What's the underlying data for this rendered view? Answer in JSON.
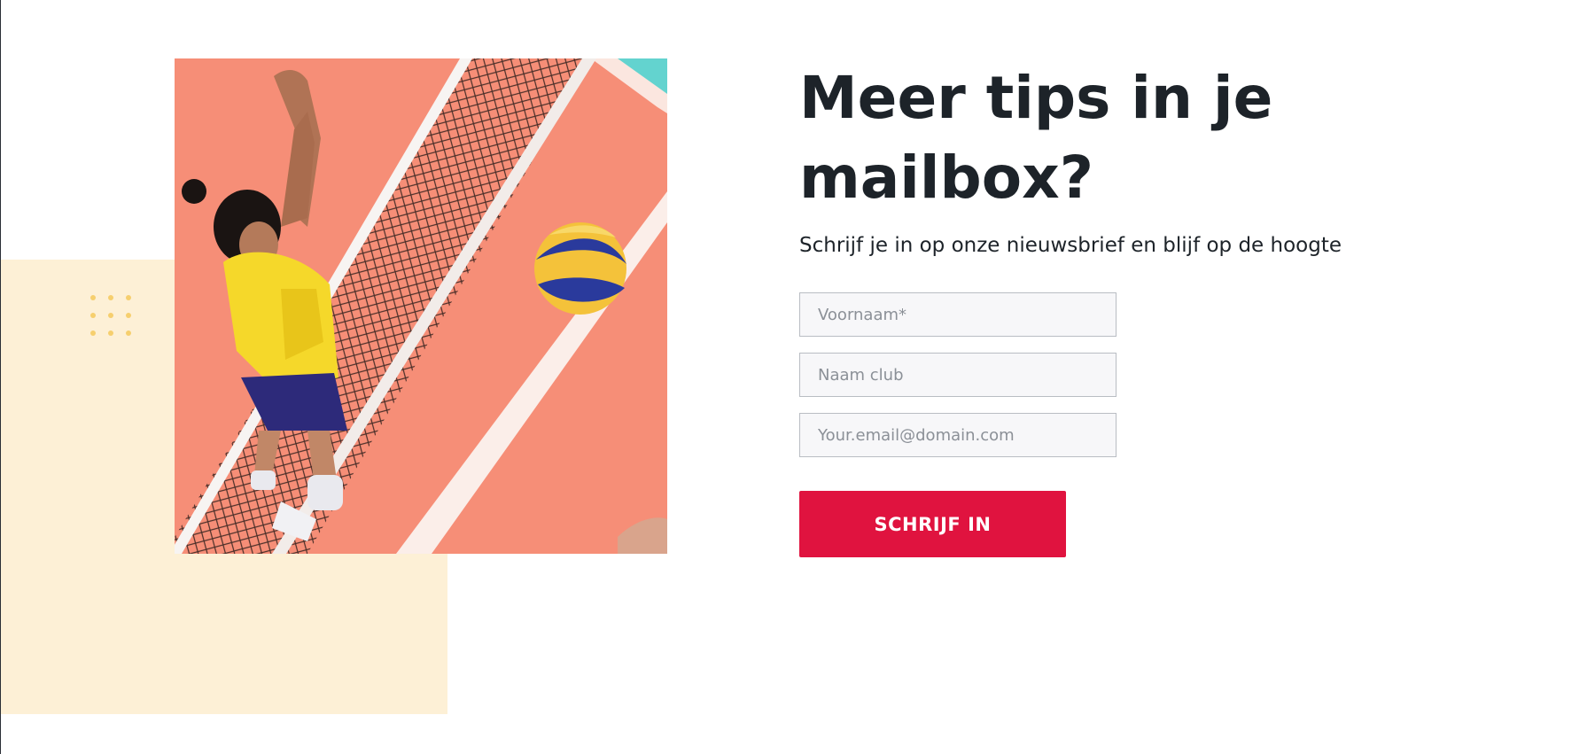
{
  "newsletter": {
    "title": "Meer tips in je mailbox?",
    "subtitle": "Schrijf je in op onze nieuwsbrief en blijf op de hoogte",
    "fields": {
      "first_name_placeholder": "Voornaam*",
      "club_placeholder": "Naam club",
      "email_placeholder": "Your.email@domain.com"
    },
    "submit_label": "SCHRIJF IN"
  },
  "colors": {
    "accent": "#e0133f",
    "heading": "#1d2329",
    "decor_block": "#fdf0d6",
    "decor_dots": "#f6cf6e"
  },
  "photo": {
    "description_icon": "volleyball-player-photo"
  }
}
